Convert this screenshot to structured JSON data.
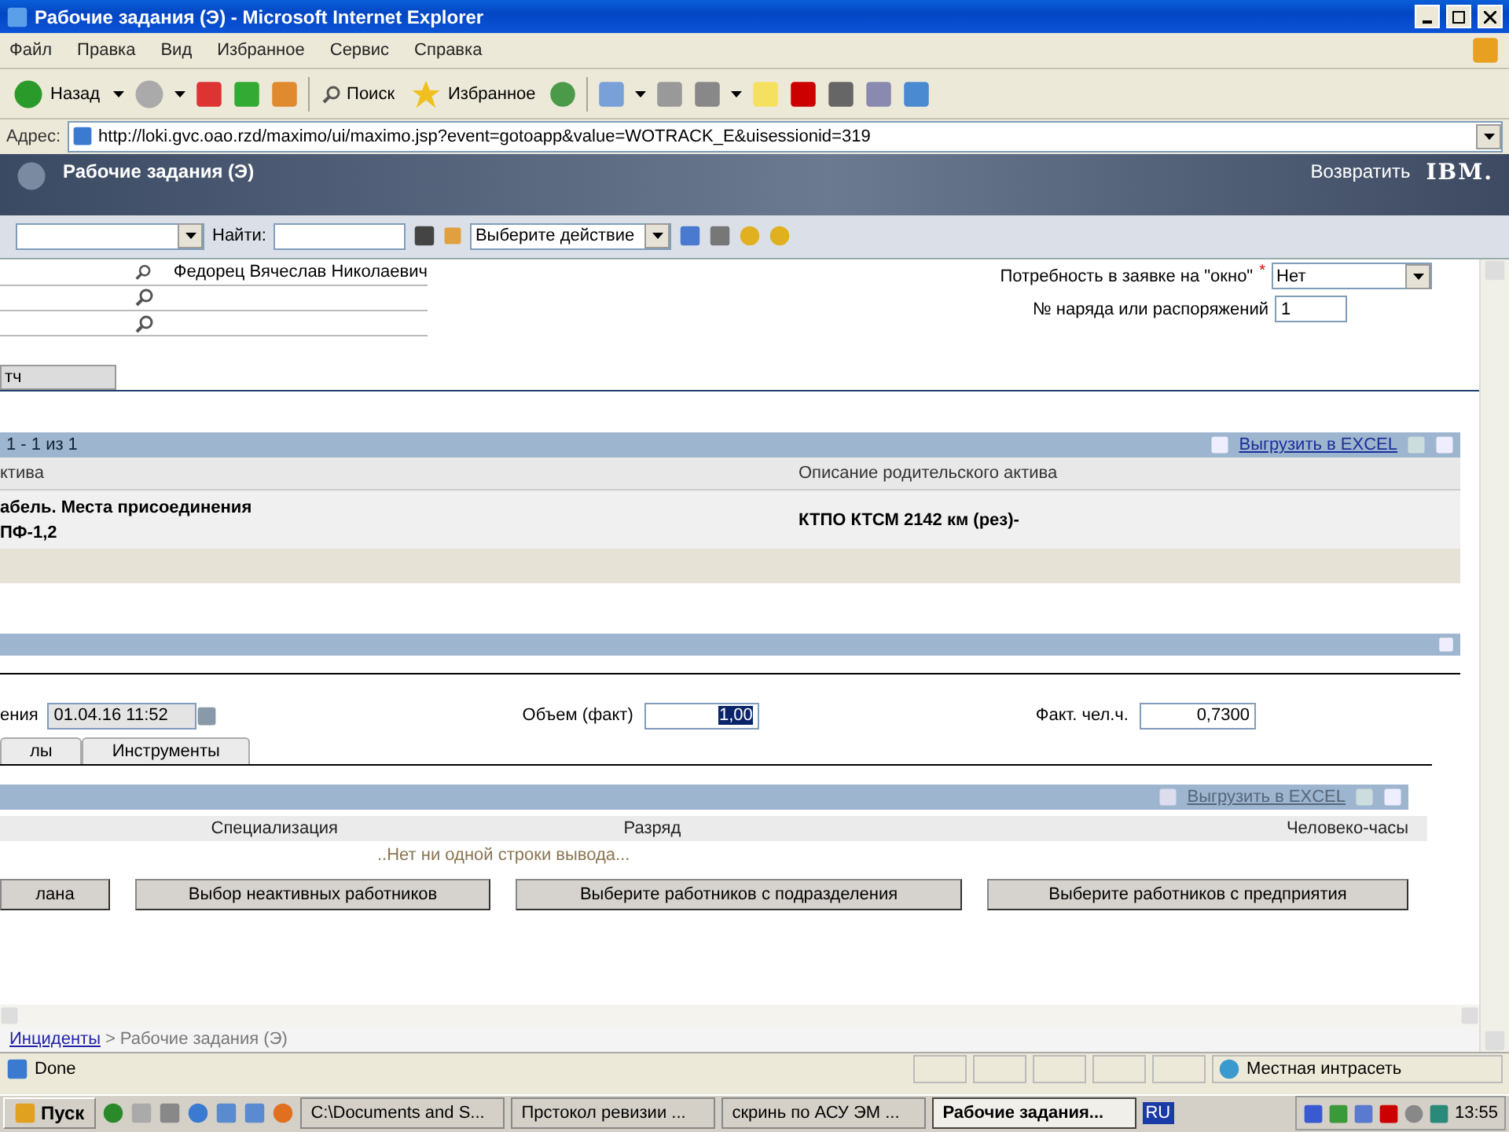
{
  "window": {
    "title": "Рабочие задания (Э) - Microsoft Internet Explorer"
  },
  "menu": [
    "Файл",
    "Правка",
    "Вид",
    "Избранное",
    "Сервис",
    "Справка"
  ],
  "toolbar": {
    "back": "Назад",
    "search": "Поиск",
    "favorites": "Избранное"
  },
  "address": {
    "label": "Адрес:",
    "url": "http://loki.gvc.oao.rzd/maximo/ui/maximo.jsp?event=gotoapp&value=WOTRACK_E&uisessionid=319"
  },
  "app_header": {
    "title": "Рабочие задания (Э)",
    "return": "Возвратить",
    "logo": "IBM."
  },
  "app_toolbar": {
    "find_label": "Найти:",
    "action": "Выберите действие"
  },
  "form_top": {
    "lookups": [
      {
        "kind": "filled",
        "value": "Федорец Вячеслав Николаевич"
      },
      {
        "kind": "empty"
      },
      {
        "kind": "empty"
      }
    ],
    "window_need": {
      "label": "Потребность в заявке на \"окно\"",
      "required_mark": "*",
      "value": "Нет"
    },
    "order_no": {
      "label": "№ наряда или распоряжений",
      "value": "1"
    },
    "cut_button": "тч"
  },
  "assets_table": {
    "pager": "1 - 1 из 1",
    "export": "Выгрузить в EXCEL",
    "columns": [
      "ктива",
      "Описание родительского актива"
    ],
    "rows": [
      {
        "cells": [
          "абель. Места присоединения\nПФ-1,2",
          "КТПО КТСМ 2142 км (рез)-"
        ]
      }
    ]
  },
  "actuals": {
    "date_label": "ения",
    "date": "01.04.16 11:52",
    "volume_label": "Объем (факт)",
    "volume": "1,00",
    "hours_label": "Факт. чел.ч.",
    "hours": "0,7300"
  },
  "tabs": [
    {
      "label": "лы",
      "selected": false
    },
    {
      "label": "Инструменты",
      "selected": false
    }
  ],
  "labor_table": {
    "export": "Выгрузить в EXCEL",
    "columns": [
      "Специализация",
      "Разряд",
      "Человеко-часы"
    ],
    "empty": "..Нет ни одной строки вывода...",
    "buttons": [
      "лана",
      "Выбор неактивных работников",
      "Выберите работников с подразделения",
      "Выберите работников с предприятия"
    ]
  },
  "breadcrumb": {
    "link": "Инциденты",
    "separator": ">",
    "current": "Рабочие задания (Э)"
  },
  "status_bar": {
    "text": "Done",
    "zone": "Местная интрасеть"
  },
  "taskbar": {
    "start": "Пуск",
    "tasks": [
      {
        "label": "C:\\Documents and S...",
        "selected": false
      },
      {
        "label": "Прстокол ревизии ...",
        "selected": false
      },
      {
        "label": "скринь по АСУ ЭМ ...",
        "selected": false
      },
      {
        "label": "Рабочие задания...",
        "selected": true
      }
    ],
    "lang": "RU",
    "clock": "13:55"
  }
}
